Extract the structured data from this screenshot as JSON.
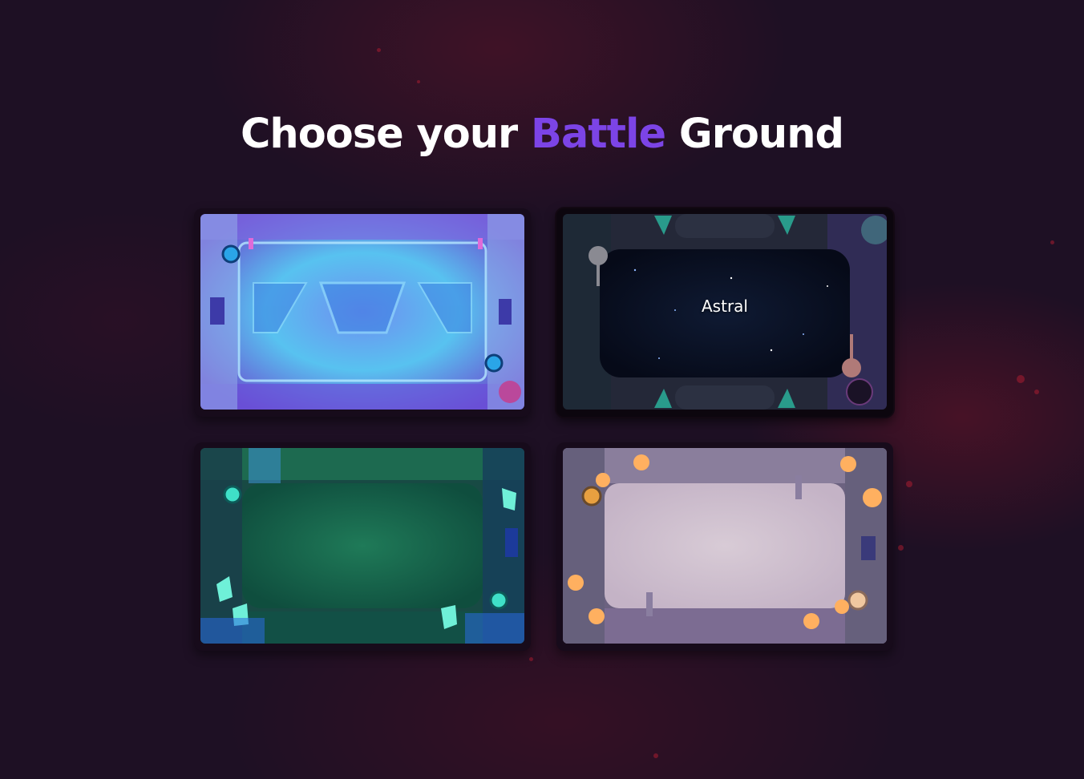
{
  "page": {
    "title_part1": "Choose your",
    "title_accent": "Battle",
    "title_part2": "Ground"
  },
  "colors": {
    "background": "#1e1024",
    "accent": "#7c44e6",
    "title": "#ffffff"
  },
  "battlegrounds": [
    {
      "id": "neon",
      "label": "",
      "selected": false,
      "theme": "cyan-blue futuristic arena"
    },
    {
      "id": "astral",
      "label": "Astral",
      "selected": true,
      "theme": "dark starry space arena"
    },
    {
      "id": "jungle",
      "label": "",
      "selected": false,
      "theme": "emerald green crystal cave arena"
    },
    {
      "id": "desert",
      "label": "",
      "selected": false,
      "theme": "lavender stone arena with lanterns"
    }
  ]
}
